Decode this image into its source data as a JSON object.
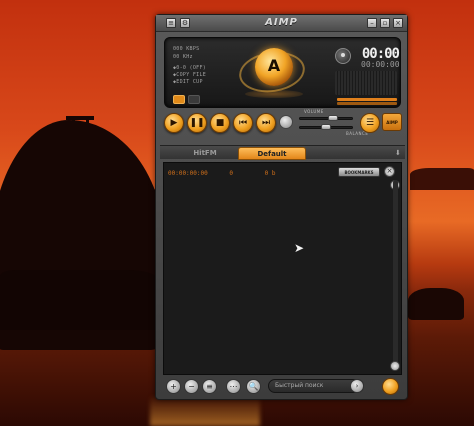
{
  "window": {
    "title": "AIMP",
    "titlebar_buttons": {
      "menu": "≡",
      "settings": "⚙",
      "minimize": "–",
      "restore": "▫",
      "close": "×"
    }
  },
  "display": {
    "info_lines": [
      "000 KBPS",
      "00 KHz",
      "◆0-0 (OFF)",
      "◆COPY FILE",
      "◆EDIT CUP"
    ],
    "time": "00:00",
    "time_small": "00:00:00"
  },
  "controls": {
    "play": "▶",
    "pause": "❚❚",
    "stop": "■",
    "prev": "⏮",
    "next": "⏭",
    "volume_label": "VOLUME",
    "balance_label": "BALANCE",
    "volume_level": 0.65,
    "balance_level": 0.5,
    "playlist_menu": "☰",
    "aimp_mini": "AIMP"
  },
  "tabs": [
    {
      "label": "HitFM",
      "active": false
    },
    {
      "label": "Default",
      "active": true
    }
  ],
  "tab_arrow": "⬇",
  "playlist": {
    "row_time": "00:00:00:00",
    "row_count": "0",
    "row_size": "0 b",
    "bookmarks_label": "BOOKMARKS",
    "close_glyph": "×"
  },
  "bottombar": {
    "add": "+",
    "remove": "−",
    "sort": "≡",
    "misc": "⋯",
    "search_btn": "🔍",
    "search_placeholder": "Быстрый поиск",
    "search_go": "›"
  },
  "colors": {
    "accent": "#f0a020",
    "playlist_text": "#d2701a",
    "playlist_bg": "#1b1b1b"
  }
}
